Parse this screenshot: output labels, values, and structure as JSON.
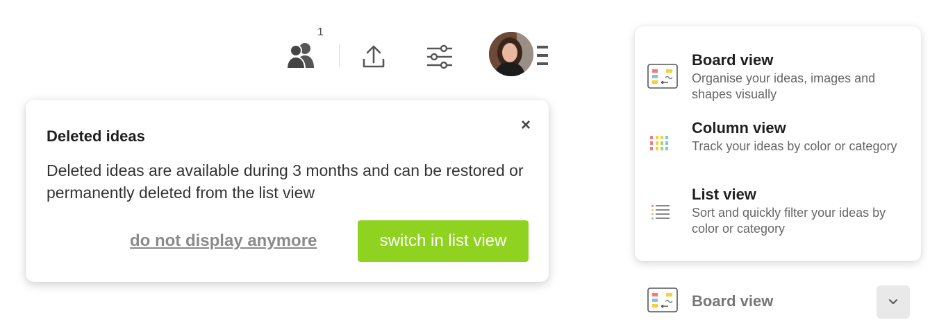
{
  "toolbar": {
    "participants_count": "1"
  },
  "popup": {
    "title": "Deleted ideas",
    "body": "Deleted ideas are available during 3 months and can be restored or permanently deleted from the list view",
    "close_label": "×",
    "dismiss_label": "do not display anymore",
    "switch_label": "switch in list view",
    "switch_color": "#8fd21f"
  },
  "view_menu": {
    "options": [
      {
        "title": "Board view",
        "description": "Organise your ideas, images and shapes visually",
        "icon": "board-view-icon"
      },
      {
        "title": "Column view",
        "description": "Track your ideas by color or category",
        "icon": "column-view-icon"
      },
      {
        "title": "List view",
        "description": "Sort and quickly filter your ideas by color or category",
        "icon": "list-view-icon"
      }
    ]
  },
  "current_view": {
    "label": "Board view",
    "icon": "board-view-icon"
  }
}
